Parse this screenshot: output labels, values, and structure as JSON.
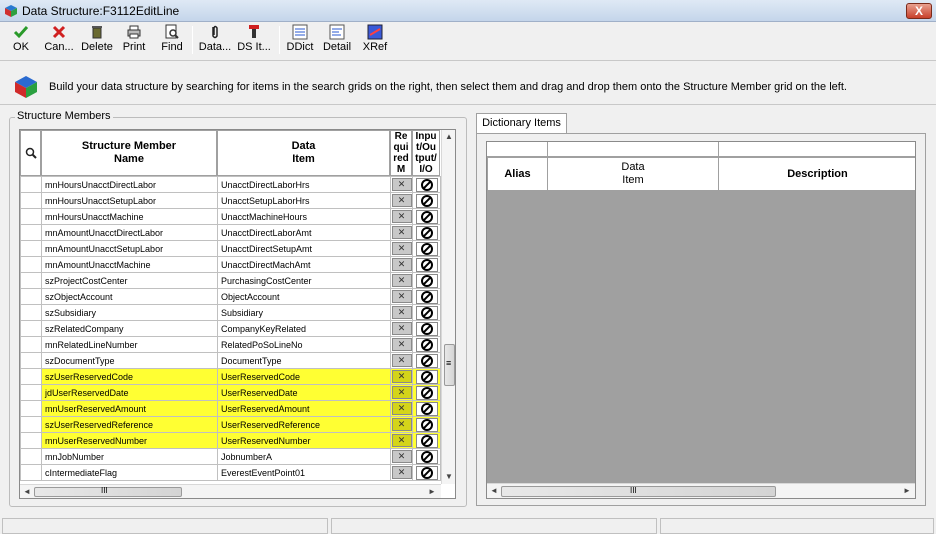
{
  "window": {
    "title": "Data Structure:F3112EditLine",
    "close_label": "X"
  },
  "toolbar": {
    "items": [
      {
        "label": "OK",
        "icon": "checkmark-icon"
      },
      {
        "label": "Can...",
        "icon": "red-x-icon"
      },
      {
        "label": "Delete",
        "icon": "trash-icon"
      },
      {
        "label": "Print",
        "icon": "printer-icon"
      },
      {
        "label": "Find",
        "icon": "find-icon"
      },
      {
        "label": "Data...",
        "icon": "paperclip-icon"
      },
      {
        "label": "DS It...",
        "icon": "ds-item-icon"
      },
      {
        "label": "DDict",
        "icon": "ddict-icon"
      },
      {
        "label": "Detail",
        "icon": "detail-icon"
      },
      {
        "label": "XRef",
        "icon": "xref-icon"
      }
    ]
  },
  "info": {
    "message": "Build your data structure by searching for items in the search grids on the right, then select them and drag and drop them onto the Structure Member grid on the left."
  },
  "members": {
    "group_label": "Structure Members",
    "headers": {
      "name": "Structure Member\nName",
      "item": "Data\nItem",
      "required": "Re\nqui\nred\nM",
      "io": "Inpu\nt/Ou\ntput/\nI/O"
    },
    "rows": [
      {
        "name": "mnHoursUnacctDirectLabor",
        "item": "UnacctDirectLaborHrs",
        "highlight": false
      },
      {
        "name": "mnHoursUnacctSetupLabor",
        "item": "UnacctSetupLaborHrs",
        "highlight": false
      },
      {
        "name": "mnHoursUnacctMachine",
        "item": "UnacctMachineHours",
        "highlight": false
      },
      {
        "name": "mnAmountUnacctDirectLabor",
        "item": "UnacctDirectLaborAmt",
        "highlight": false
      },
      {
        "name": "mnAmountUnacctSetupLabor",
        "item": "UnacctDirectSetupAmt",
        "highlight": false
      },
      {
        "name": "mnAmountUnacctMachine",
        "item": "UnacctDirectMachAmt",
        "highlight": false
      },
      {
        "name": "szProjectCostCenter",
        "item": "PurchasingCostCenter",
        "highlight": false
      },
      {
        "name": "szObjectAccount",
        "item": "ObjectAccount",
        "highlight": false
      },
      {
        "name": "szSubsidiary",
        "item": "Subsidiary",
        "highlight": false
      },
      {
        "name": "szRelatedCompany",
        "item": "CompanyKeyRelated",
        "highlight": false
      },
      {
        "name": "mnRelatedLineNumber",
        "item": "RelatedPoSoLineNo",
        "highlight": false
      },
      {
        "name": "szDocumentType",
        "item": "DocumentType",
        "highlight": false
      },
      {
        "name": "szUserReservedCode",
        "item": "UserReservedCode",
        "highlight": true
      },
      {
        "name": "jdUserReservedDate",
        "item": "UserReservedDate",
        "highlight": true
      },
      {
        "name": "mnUserReservedAmount",
        "item": "UserReservedAmount",
        "highlight": true
      },
      {
        "name": "szUserReservedReference",
        "item": "UserReservedReference",
        "highlight": true
      },
      {
        "name": "mnUserReservedNumber",
        "item": "UserReservedNumber",
        "highlight": true
      },
      {
        "name": "mnJobNumber",
        "item": "JobnumberA",
        "highlight": false
      },
      {
        "name": "cIntermediateFlag",
        "item": "EverestEventPoint01",
        "highlight": false
      }
    ],
    "x_glyph": "✕"
  },
  "dictionary": {
    "tab_label": "Dictionary Items",
    "headers": {
      "alias": "Alias",
      "item": "Data\nItem",
      "description": "Description"
    }
  },
  "scroll": {
    "h_grip": "III",
    "v_grip": "≡",
    "up": "▲",
    "down": "▼",
    "left": "◄",
    "right": "►"
  },
  "colors": {
    "highlight": "#ffff33",
    "grid_empty": "#a0a0a0"
  }
}
